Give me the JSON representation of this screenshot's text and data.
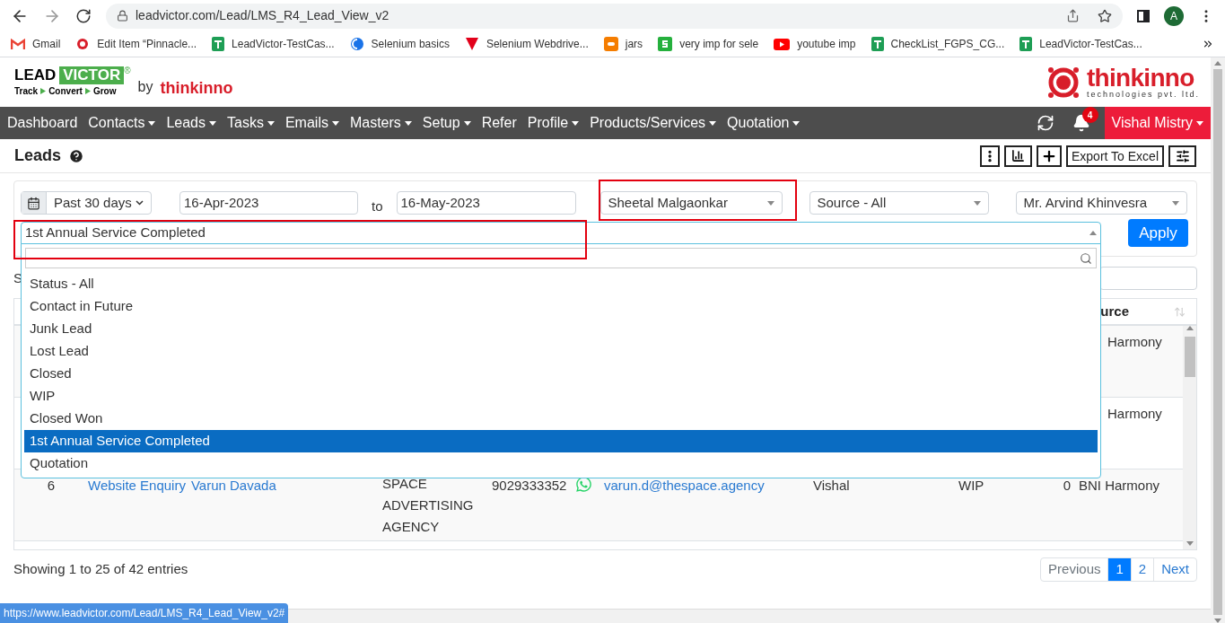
{
  "browser": {
    "url": "leadvictor.com/Lead/LMS_R4_Lead_View_v2",
    "profile_initial": "A",
    "bookmarks": [
      {
        "label": "Gmail",
        "kind": "mail"
      },
      {
        "label": "Edit Item “Pinnacle...",
        "kind": "brand"
      },
      {
        "label": "LeadVictor-TestCas...",
        "kind": "sheet"
      },
      {
        "label": "Selenium basics",
        "kind": "globe"
      },
      {
        "label": "Selenium Webdrive...",
        "kind": "triangle"
      },
      {
        "label": "jars",
        "kind": "blog"
      },
      {
        "label": "very imp for sele",
        "kind": "site"
      },
      {
        "label": "youtube imp",
        "kind": "video"
      },
      {
        "label": "CheckList_FGPS_CG...",
        "kind": "sheet"
      },
      {
        "label": "LeadVictor-TestCas...",
        "kind": "sheet"
      }
    ],
    "status_url": "https://www.leadvictor.com/Lead/LMS_R4_Lead_View_v2#"
  },
  "header": {
    "logo": {
      "lead": "LEAD",
      "victor": "VICTOR",
      "registered": "®",
      "tagline": [
        "Track",
        "Convert",
        "Grow"
      ],
      "by": "by",
      "maker": "thinkinno"
    },
    "company": {
      "name": "thinkinno",
      "subtitle": "technologies pvt. ltd."
    }
  },
  "nav": {
    "items": [
      {
        "label": "Dashboard",
        "dropdown": false
      },
      {
        "label": "Contacts",
        "dropdown": true
      },
      {
        "label": "Leads",
        "dropdown": true
      },
      {
        "label": "Tasks",
        "dropdown": true
      },
      {
        "label": "Emails",
        "dropdown": true
      },
      {
        "label": "Masters",
        "dropdown": true
      },
      {
        "label": "Setup",
        "dropdown": true
      },
      {
        "label": "Refer",
        "dropdown": false
      },
      {
        "label": "Profile",
        "dropdown": true
      },
      {
        "label": "Products/Services",
        "dropdown": true
      },
      {
        "label": "Quotation",
        "dropdown": true
      }
    ],
    "notification_count": "4",
    "user": "Vishal Mistry"
  },
  "page": {
    "title": "Leads",
    "export_button": "Export To Excel"
  },
  "filters": {
    "period": "Past 30 days",
    "from_date": "16-Apr-2023",
    "to_label": "to",
    "to_date": "16-May-2023",
    "user": "Sheetal Malgaonkar",
    "source": "Source - All",
    "manager": "Mr. Arvind Khinvesra",
    "status": {
      "value": "1st Annual Service Completed",
      "expanded": true,
      "options": [
        {
          "label": "Status - All",
          "selected": false
        },
        {
          "label": "Contact in Future",
          "selected": false
        },
        {
          "label": "Junk Lead",
          "selected": false
        },
        {
          "label": "Lost Lead",
          "selected": false
        },
        {
          "label": "Closed",
          "selected": false
        },
        {
          "label": "WIP",
          "selected": false
        },
        {
          "label": "Closed Won",
          "selected": false
        },
        {
          "label": "1st Annual Service Completed",
          "selected": true
        },
        {
          "label": "Quotation",
          "selected": false
        }
      ]
    },
    "apply": "Apply"
  },
  "table": {
    "length_label": "S",
    "source_header": "urce",
    "rows": [
      {
        "source": "Harmony"
      },
      {
        "source": "Harmony"
      },
      {
        "number": "6",
        "enquiry": "Website Enquiry",
        "name": "Varun Davada",
        "company": "SPACE ADVERTISING AGENCY",
        "phone": "9029333352",
        "email": "varun.d@thespace.agency",
        "assigned": "Vishal",
        "status": "WIP",
        "count": "0",
        "source": "BNI Harmony"
      }
    ],
    "info": "Showing 1 to 25 of 42 entries",
    "pagination": [
      {
        "label": "Previous",
        "kind": "prev",
        "selected": false
      },
      {
        "label": "1",
        "kind": "page",
        "selected": true
      },
      {
        "label": "2",
        "kind": "page",
        "selected": false
      },
      {
        "label": "Next",
        "kind": "next",
        "selected": false
      }
    ]
  }
}
